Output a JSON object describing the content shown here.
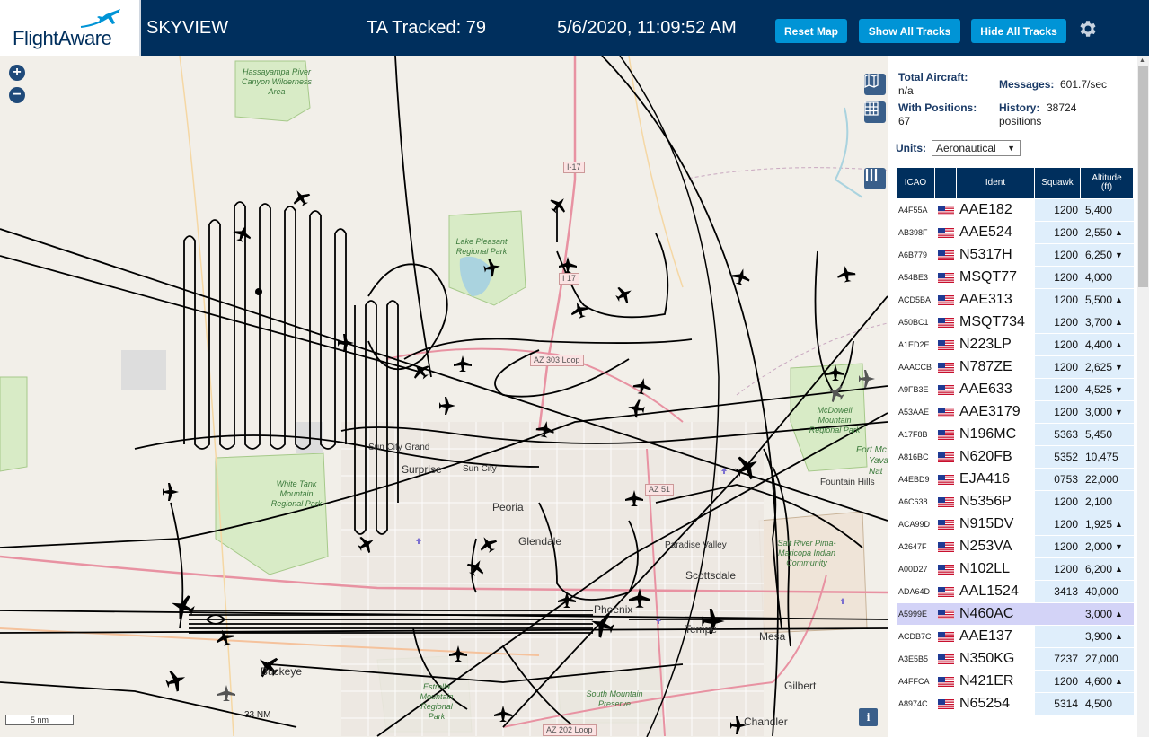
{
  "header": {
    "logo_text": "FlightAware",
    "app_title": "SKYVIEW",
    "ta_tracked": "TA Tracked: 79",
    "clock": "5/6/2020, 11:09:52 AM",
    "buttons": {
      "reset": "Reset Map",
      "show_all": "Show All Tracks",
      "hide_all": "Hide All Tracks"
    }
  },
  "map": {
    "zoom_in": "+",
    "zoom_out": "−",
    "scale_label": "5 nm",
    "scale_nm": "33 NM",
    "info": "i",
    "parks": [
      "Hassayampa River Canyon Wilderness Area",
      "Lake Pleasant Regional Park",
      "White Tank Mountain Regional Park",
      "McDowell Mountain Regional Park",
      "Estrella Mountain Regional Park",
      "South Mountain Preserve",
      "Salt River Pima-Maricopa Indian Community"
    ],
    "cities": {
      "surprise": "Surprise",
      "sun_city": "Sun City",
      "sun_city_grand": "Sun City Grand",
      "peoria": "Peoria",
      "glendale": "Glendale",
      "paradise_valley": "Paradise Valley",
      "scottsdale": "Scottsdale",
      "phoenix": "Phoenix",
      "tempe": "Tempe",
      "mesa": "Mesa",
      "gilbert": "Gilbert",
      "chandler": "Chandler",
      "buckeye": "Buckeye",
      "fountain_hills": "Fountain Hills",
      "fort_mc": "Fort Mc",
      "yava": "Yava",
      "nat": "Nat"
    },
    "roads": {
      "i17": "I-17",
      "i17b": "I 17",
      "az303": "AZ 303 Loop",
      "az51": "AZ 51",
      "az202": "AZ 202 Loop"
    }
  },
  "sidebar": {
    "total_aircraft_label": "Total Aircraft:",
    "total_aircraft_value": "n/a",
    "messages_label": "Messages:",
    "messages_value": "601.7/sec",
    "with_positions_label": "With Positions:",
    "with_positions_value": "67",
    "history_label": "History:",
    "history_value_1": "38724",
    "history_value_2": "positions",
    "units_label": "Units:",
    "units_value": "Aeronautical",
    "columns": {
      "icao": "ICAO",
      "ident": "Ident",
      "squawk": "Squawk",
      "altitude_1": "Altitude",
      "altitude_2": "(ft)"
    },
    "rows": [
      {
        "icao": "A4F55A",
        "ident": "AAE182",
        "squawk": "1200",
        "alt": "5,400",
        "trend": ""
      },
      {
        "icao": "AB398F",
        "ident": "AAE524",
        "squawk": "1200",
        "alt": "2,550",
        "trend": "▲"
      },
      {
        "icao": "A6B779",
        "ident": "N5317H",
        "squawk": "1200",
        "alt": "6,250",
        "trend": "▼"
      },
      {
        "icao": "A54BE3",
        "ident": "MSQT77",
        "squawk": "1200",
        "alt": "4,000",
        "trend": ""
      },
      {
        "icao": "ACD5BA",
        "ident": "AAE313",
        "squawk": "1200",
        "alt": "5,500",
        "trend": "▲"
      },
      {
        "icao": "A50BC1",
        "ident": "MSQT734",
        "squawk": "1200",
        "alt": "3,700",
        "trend": "▲"
      },
      {
        "icao": "A1ED2E",
        "ident": "N223LP",
        "squawk": "1200",
        "alt": "4,400",
        "trend": "▲"
      },
      {
        "icao": "AAACCB",
        "ident": "N787ZE",
        "squawk": "1200",
        "alt": "2,625",
        "trend": "▼"
      },
      {
        "icao": "A9FB3E",
        "ident": "AAE633",
        "squawk": "1200",
        "alt": "4,525",
        "trend": "▼"
      },
      {
        "icao": "A53AAE",
        "ident": "AAE3179",
        "squawk": "1200",
        "alt": "3,000",
        "trend": "▼"
      },
      {
        "icao": "A17F8B",
        "ident": "N196MC",
        "squawk": "5363",
        "alt": "5,450",
        "trend": ""
      },
      {
        "icao": "A816BC",
        "ident": "N620FB",
        "squawk": "5352",
        "alt": "10,475",
        "trend": ""
      },
      {
        "icao": "A4EBD9",
        "ident": "EJA416",
        "squawk": "0753",
        "alt": "22,000",
        "trend": ""
      },
      {
        "icao": "A6C638",
        "ident": "N5356P",
        "squawk": "1200",
        "alt": "2,100",
        "trend": ""
      },
      {
        "icao": "ACA99D",
        "ident": "N915DV",
        "squawk": "1200",
        "alt": "1,925",
        "trend": "▲"
      },
      {
        "icao": "A2647F",
        "ident": "N253VA",
        "squawk": "1200",
        "alt": "2,000",
        "trend": "▼"
      },
      {
        "icao": "A00D27",
        "ident": "N102LL",
        "squawk": "1200",
        "alt": "6,200",
        "trend": "▲"
      },
      {
        "icao": "ADA64D",
        "ident": "AAL1524",
        "squawk": "3413",
        "alt": "40,000",
        "trend": ""
      },
      {
        "icao": "A5999E",
        "ident": "N460AC",
        "squawk": "",
        "alt": "3,000",
        "trend": "▲"
      },
      {
        "icao": "ACDB7C",
        "ident": "AAE137",
        "squawk": "",
        "alt": "3,900",
        "trend": "▲"
      },
      {
        "icao": "A3E5B5",
        "ident": "N350KG",
        "squawk": "7237",
        "alt": "27,000",
        "trend": ""
      },
      {
        "icao": "A4FFCA",
        "ident": "N421ER",
        "squawk": "1200",
        "alt": "4,600",
        "trend": "▲"
      },
      {
        "icao": "A8974C",
        "ident": "N65254",
        "squawk": "5314",
        "alt": "4,500",
        "trend": ""
      }
    ]
  },
  "colors": {
    "header_bg": "#002f5d",
    "button_bg": "#0094d6",
    "selected_row": "#d3d3f7",
    "squawk_cell": "#dfeefb"
  }
}
